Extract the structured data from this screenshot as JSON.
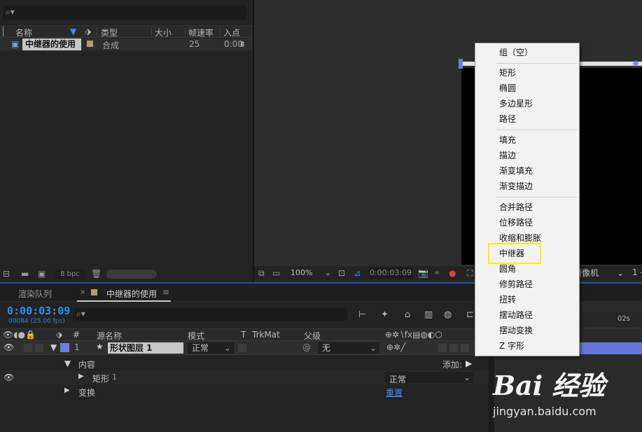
{
  "project": {
    "columns": [
      "名称",
      "类型",
      "大小",
      "帧速率",
      "入点"
    ],
    "item": {
      "name": "中继器的使用",
      "type": "合成",
      "fps": "25",
      "inpoint": "0:00"
    },
    "bpc": "8 bpc"
  },
  "viewer": {
    "zoom": "100%",
    "time": "0:00:03:09",
    "camera": "摄像机",
    "views": "1 -"
  },
  "timeline": {
    "tabs": {
      "render_queue": "渲染队列",
      "comp": "中继器的使用"
    },
    "timecode": "0:00:03:09",
    "frames_fps": "00084 (25.00 fps)",
    "columns": {
      "num": "#",
      "source_name": "源名称",
      "mode": "模式",
      "t": "T",
      "trkmat": "TrkMat",
      "parent": "父级"
    },
    "layer": {
      "index": "1",
      "name": "形状图层 1",
      "mode": "正常",
      "parent": "无"
    },
    "contents_label": "内容",
    "add_label": "添加:",
    "rectangle": {
      "name": "矩形",
      "index": "1",
      "mode": "正常"
    },
    "transform": {
      "name": "变换",
      "reset": "重置"
    },
    "ruler_label": "02s"
  },
  "context_menu": {
    "items": [
      {
        "label": "组（空）"
      },
      {
        "label": "矩形"
      },
      {
        "label": "椭圆"
      },
      {
        "label": "多边星形"
      },
      {
        "label": "路径"
      },
      {
        "label": "填充"
      },
      {
        "label": "描边"
      },
      {
        "label": "渐变填充"
      },
      {
        "label": "渐变描边"
      },
      {
        "label": "合并路径"
      },
      {
        "label": "位移路径"
      },
      {
        "label": "收缩和膨胀"
      },
      {
        "label": "中继器"
      },
      {
        "label": "圆角"
      },
      {
        "label": "修剪路径"
      },
      {
        "label": "扭转"
      },
      {
        "label": "摆动路径"
      },
      {
        "label": "摆动变换"
      },
      {
        "label": "Z 字形"
      }
    ],
    "highlighted": "中继器",
    "highlight_color": "#f2f200"
  },
  "watermark": {
    "brand": "Bai 经验",
    "url": "jingyan.baidu.com"
  },
  "colors": {
    "accent_blue": "#2f8ef2",
    "layer_label": "#6d7ce4",
    "comp_label": "#b49d72"
  }
}
